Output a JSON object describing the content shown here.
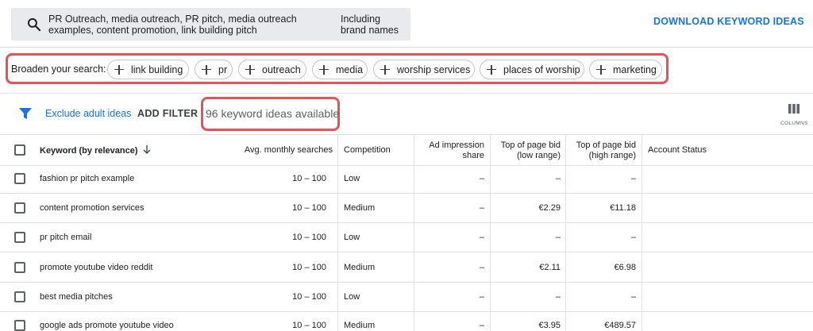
{
  "search": {
    "query": "PR Outreach, media outreach, PR pitch, media outreach examples, content promotion, link building pitch",
    "option": "Including brand names"
  },
  "header": {
    "download_label": "DOWNLOAD KEYWORD IDEAS"
  },
  "broaden": {
    "label": "Broaden your search:",
    "chips": [
      "link building",
      "pr",
      "outreach",
      "media",
      "worship services",
      "places of worship",
      "marketing"
    ]
  },
  "filters": {
    "exclude_label": "Exclude adult ideas",
    "add_filter_label": "ADD FILTER",
    "ideas_count": "96 keyword ideas available",
    "columns_label": "COLUMNS"
  },
  "table": {
    "headers": {
      "keyword": "Keyword (by relevance)",
      "searches": "Avg. monthly searches",
      "competition": "Competition",
      "ad_share_1": "Ad impression",
      "ad_share_2": "share",
      "bid_low_1": "Top of page bid",
      "bid_low_2": "(low range)",
      "bid_high_1": "Top of page bid",
      "bid_high_2": "(high range)",
      "account": "Account Status"
    },
    "rows": [
      {
        "keyword": "fashion pr pitch example",
        "searches": "10 – 100",
        "competition": "Low",
        "ad_share": "–",
        "bid_low": "–",
        "bid_high": "–"
      },
      {
        "keyword": "content promotion services",
        "searches": "10 – 100",
        "competition": "Medium",
        "ad_share": "–",
        "bid_low": "€2.29",
        "bid_high": "€11.18"
      },
      {
        "keyword": "pr pitch email",
        "searches": "10 – 100",
        "competition": "Low",
        "ad_share": "–",
        "bid_low": "–",
        "bid_high": "–"
      },
      {
        "keyword": "promote youtube video reddit",
        "searches": "10 – 100",
        "competition": "Medium",
        "ad_share": "–",
        "bid_low": "€2.11",
        "bid_high": "€6.98"
      },
      {
        "keyword": "best media pitches",
        "searches": "10 – 100",
        "competition": "Low",
        "ad_share": "–",
        "bid_low": "–",
        "bid_high": "–"
      },
      {
        "keyword": "google ads promote youtube video",
        "searches": "10 – 100",
        "competition": "Medium",
        "ad_share": "–",
        "bid_low": "€3.95",
        "bid_high": "€489.57"
      }
    ]
  },
  "colors": {
    "accent": "#1a73e8",
    "highlight": "#e8505b",
    "search_bg": "#e8eaed"
  },
  "icons": [
    "search-icon",
    "plus-icon",
    "filter-icon",
    "columns-icon",
    "arrow-down-icon",
    "checkbox-icon"
  ]
}
